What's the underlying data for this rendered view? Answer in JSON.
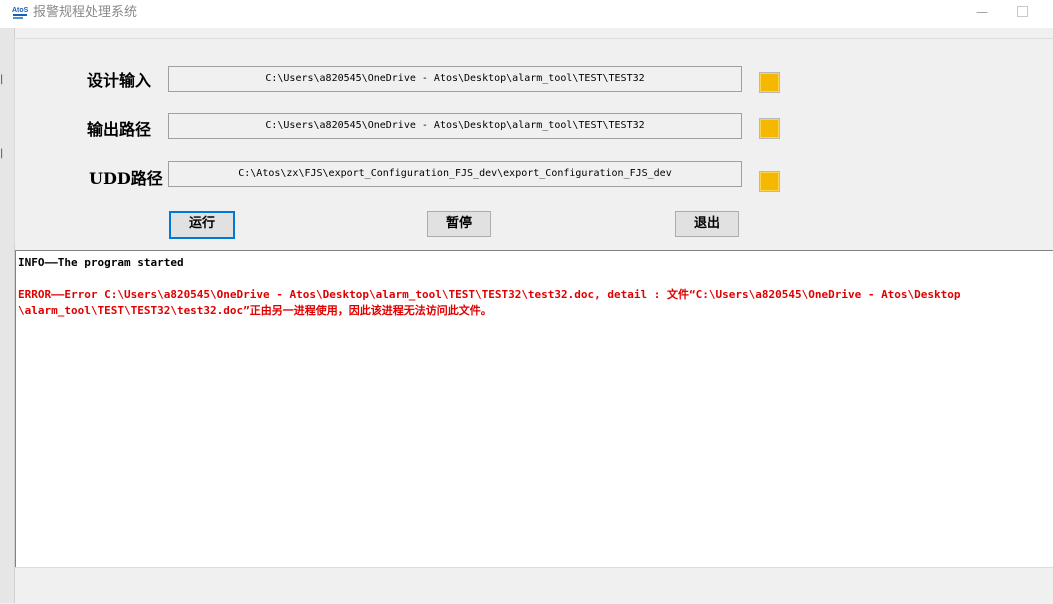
{
  "window": {
    "title": "报警规程处理系统",
    "minimize_glyph": "—"
  },
  "form": {
    "rows": [
      {
        "label": "设计输入",
        "value": "C:\\Users\\a820545\\OneDrive - Atos\\Desktop\\alarm_tool\\TEST\\TEST32"
      },
      {
        "label": "输出路径",
        "value": "C:\\Users\\a820545\\OneDrive - Atos\\Desktop\\alarm_tool\\TEST\\TEST32"
      },
      {
        "label": "UDD路径",
        "value": "C:\\Atos\\zx\\FJS\\export_Configuration_FJS_dev\\export_Configuration_FJS_dev"
      }
    ],
    "browse_color": "#f5b800"
  },
  "buttons": {
    "run": "运行",
    "pause": "暂停",
    "exit": "退出"
  },
  "log": {
    "info": "INFO——The program started",
    "error_line1": "ERROR——Error C:\\Users\\a820545\\OneDrive - Atos\\Desktop\\alarm_tool\\TEST\\TEST32\\test32.doc, detail : 文件“C:\\Users\\a820545\\OneDrive - Atos\\Desktop",
    "error_line2": "\\alarm_tool\\TEST\\TEST32\\test32.doc”正由另一进程使用，因此该进程无法访问此文件。",
    "error_color": "#e00000"
  }
}
